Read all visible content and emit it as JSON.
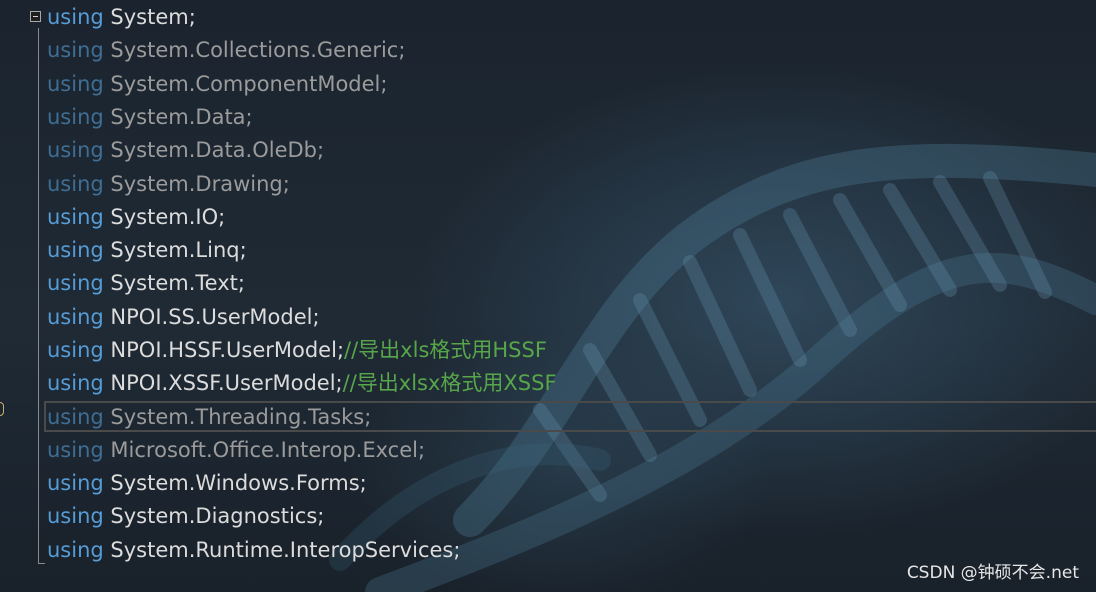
{
  "editor": {
    "lines": [
      {
        "keyword": "using",
        "namespace": "System;",
        "comment": "",
        "dimmed": false
      },
      {
        "keyword": "using",
        "namespace": "System.Collections.Generic;",
        "comment": "",
        "dimmed": true
      },
      {
        "keyword": "using",
        "namespace": "System.ComponentModel;",
        "comment": "",
        "dimmed": true
      },
      {
        "keyword": "using",
        "namespace": "System.Data;",
        "comment": "",
        "dimmed": true
      },
      {
        "keyword": "using",
        "namespace": "System.Data.OleDb;",
        "comment": "",
        "dimmed": true
      },
      {
        "keyword": "using",
        "namespace": "System.Drawing;",
        "comment": "",
        "dimmed": true
      },
      {
        "keyword": "using",
        "namespace": "System.IO;",
        "comment": "",
        "dimmed": false
      },
      {
        "keyword": "using",
        "namespace": "System.Linq;",
        "comment": "",
        "dimmed": false
      },
      {
        "keyword": "using",
        "namespace": "System.Text;",
        "comment": "",
        "dimmed": false
      },
      {
        "keyword": "using",
        "namespace": "NPOI.SS.UserModel;",
        "comment": "",
        "dimmed": false
      },
      {
        "keyword": "using",
        "namespace": "NPOI.HSSF.UserModel;",
        "comment": "//导出xls格式用HSSF",
        "dimmed": false
      },
      {
        "keyword": "using",
        "namespace": "NPOI.XSSF.UserModel;",
        "comment": "//导出xlsx格式用XSSF",
        "dimmed": false
      },
      {
        "keyword": "using",
        "namespace": "System.Threading.Tasks;",
        "comment": "",
        "dimmed": true
      },
      {
        "keyword": "using",
        "namespace": "Microsoft.Office.Interop.Excel;",
        "comment": "",
        "dimmed": true
      },
      {
        "keyword": "using",
        "namespace": "System.Windows.Forms;",
        "comment": "",
        "dimmed": false
      },
      {
        "keyword": "using",
        "namespace": "System.Diagnostics;",
        "comment": "",
        "dimmed": false
      },
      {
        "keyword": "using",
        "namespace": "System.Runtime.InteropServices;",
        "comment": "",
        "dimmed": false
      }
    ],
    "current_line": 13,
    "fold_state": "expanded"
  },
  "colors": {
    "keyword": "#569cd6",
    "text": "#dcdcdc",
    "comment": "#57a64a",
    "dimmed_text": "#9b9b9b"
  },
  "watermark": "CSDN @钟硕不会.net"
}
